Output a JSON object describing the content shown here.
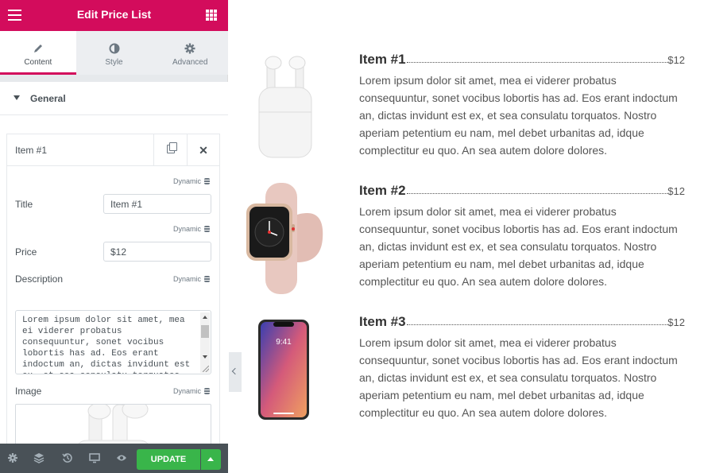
{
  "panel": {
    "title": "Edit Price List",
    "tabs": [
      {
        "label": "Content",
        "icon": "pencil-icon",
        "active": true
      },
      {
        "label": "Style",
        "icon": "contrast-icon",
        "active": false
      },
      {
        "label": "Advanced",
        "icon": "gear-icon",
        "active": false
      }
    ],
    "section": "General",
    "item": {
      "name": "Item #1",
      "dynamic_label": "Dynamic",
      "title_label": "Title",
      "title_value": "Item #1",
      "price_label": "Price",
      "price_value": "$12",
      "description_label": "Description",
      "description_value": "Lorem ipsum dolor sit amet, mea ei viderer probatus consequuntur, sonet vocibus lobortis has ad. Eos erant indoctum an, dictas invidunt est ex, et sea consulatu torquatos.",
      "image_label": "Image"
    },
    "footer": {
      "update_label": "UPDATE",
      "icons": [
        "settings-icon",
        "layers-icon",
        "history-icon",
        "responsive-icon",
        "preview-eye-icon"
      ]
    }
  },
  "preview": {
    "items": [
      {
        "title": "Item #1",
        "price": "$12",
        "image": "airpods",
        "description": "Lorem ipsum dolor sit amet, mea ei viderer probatus consequuntur, sonet vocibus lobortis has ad. Eos erant indoctum an, dictas invidunt est ex, et sea consulatu torquatos. Nostro aperiam petentium eu nam, mel debet urbanitas ad, idque complectitur eu quo. An sea autem dolore dolores."
      },
      {
        "title": "Item #2",
        "price": "$12",
        "image": "apple-watch",
        "description": "Lorem ipsum dolor sit amet, mea ei viderer probatus consequuntur, sonet vocibus lobortis has ad. Eos erant indoctum an, dictas invidunt est ex, et sea consulatu torquatos. Nostro aperiam petentium eu nam, mel debet urbanitas ad, idque complectitur eu quo. An sea autem dolore dolores."
      },
      {
        "title": "Item #3",
        "price": "$12",
        "image": "iphone-x",
        "description": "Lorem ipsum dolor sit amet, mea ei viderer probatus consequuntur, sonet vocibus lobortis has ad. Eos erant indoctum an, dictas invidunt est ex, et sea consulatu torquatos. Nostro aperiam petentium eu nam, mel debet urbanitas ad, idque complectitur eu quo. An sea autem dolore dolores."
      }
    ],
    "phone_time": "9:41"
  },
  "colors": {
    "brand": "#d30c5c",
    "update": "#39b54a",
    "footer": "#495157"
  }
}
